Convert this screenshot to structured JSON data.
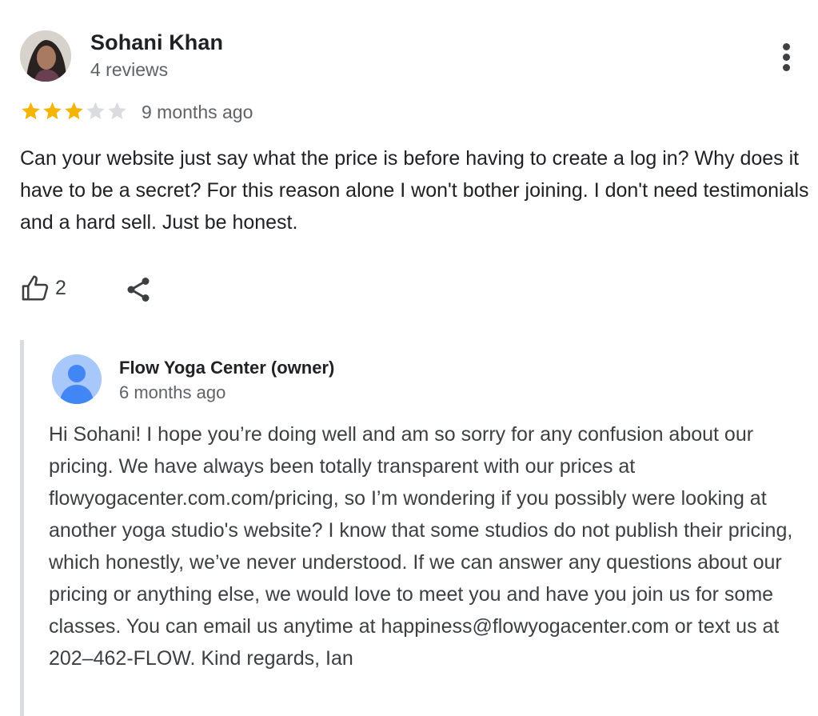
{
  "review": {
    "author": {
      "name": "Sohani Khan",
      "meta": "4 reviews"
    },
    "rating": 3,
    "rating_max": 5,
    "date": "9 months ago",
    "text": "Can your website just say what the price is before having to create a log in? Why does it have to be a secret? For this reason alone I won't bother joining. I don't need testimonials and a hard sell. Just be honest.",
    "likes": "2",
    "icons": {
      "more": "more-vertical-icon",
      "like": "thumbs-up-icon",
      "share": "share-icon"
    }
  },
  "owner_reply": {
    "name": "Flow Yoga Center (owner)",
    "date": "6 months ago",
    "text": "Hi Sohani! I hope you’re doing well and am so sorry for any confusion about our pricing. We have always been totally transparent with our prices at flowyogacenter.com.com/pricing, so I’m wondering if you possibly were looking at another yoga studio's website? I know that some studios do not publish their pricing, which honestly, we’ve never understood. If we can answer any questions about our pricing or anything else, we would love to meet you and have you join us for some classes. You can email us anytime at happiness@flowyogacenter.com or text us at 202–462-FLOW. Kind regards, Ian"
  },
  "colors": {
    "star_filled": "#f4b400",
    "star_empty": "#dadce0",
    "text_primary": "#202124",
    "text_secondary": "#5f6368",
    "reply_border": "#dadce0",
    "owner_avatar_bg": "#a8c7fa",
    "owner_avatar_fg": "#4285f4"
  }
}
